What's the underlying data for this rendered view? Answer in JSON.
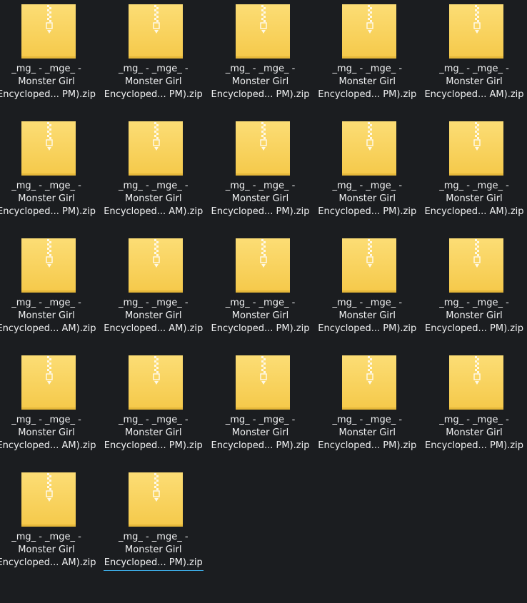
{
  "colors": {
    "background": "#1b1d20",
    "text": "#eff0f1",
    "folder_top": "#fcdd75",
    "folder_bottom": "#f5c94a",
    "zipper": "#ffffff",
    "focus_underline": "#3daee9"
  },
  "icon": "zip-archive-icon",
  "files": [
    {
      "line1": "_mg_ - _mge_ -",
      "line2": "Monster Girl",
      "line3": "Encycloped... PM).zip"
    },
    {
      "line1": "_mg_ - _mge_ -",
      "line2": "Monster Girl",
      "line3": "Encycloped... PM).zip"
    },
    {
      "line1": "_mg_ - _mge_ -",
      "line2": "Monster Girl",
      "line3": "Encycloped... PM).zip"
    },
    {
      "line1": "_mg_ - _mge_ -",
      "line2": "Monster Girl",
      "line3": "Encycloped... PM).zip"
    },
    {
      "line1": "_mg_ - _mge_ -",
      "line2": "Monster Girl",
      "line3": "Encycloped... AM).zip"
    },
    {
      "line1": "_mg_ - _mge_ -",
      "line2": "Monster Girl",
      "line3": "Encycloped... PM).zip"
    },
    {
      "line1": "_mg_ - _mge_ -",
      "line2": "Monster Girl",
      "line3": "Encycloped... AM).zip"
    },
    {
      "line1": "_mg_ - _mge_ -",
      "line2": "Monster Girl",
      "line3": "Encycloped... PM).zip"
    },
    {
      "line1": "_mg_ - _mge_ -",
      "line2": "Monster Girl",
      "line3": "Encycloped... PM).zip"
    },
    {
      "line1": "_mg_ - _mge_ -",
      "line2": "Monster Girl",
      "line3": "Encycloped... AM).zip"
    },
    {
      "line1": "_mg_ - _mge_ -",
      "line2": "Monster Girl",
      "line3": "Encycloped... AM).zip"
    },
    {
      "line1": "_mg_ - _mge_ -",
      "line2": "Monster Girl",
      "line3": "Encycloped... AM).zip"
    },
    {
      "line1": "_mg_ - _mge_ -",
      "line2": "Monster Girl",
      "line3": "Encycloped... PM).zip"
    },
    {
      "line1": "_mg_ - _mge_ -",
      "line2": "Monster Girl",
      "line3": "Encycloped... PM).zip"
    },
    {
      "line1": "_mg_ - _mge_ -",
      "line2": "Monster Girl",
      "line3": "Encycloped... PM).zip"
    },
    {
      "line1": "_mg_ - _mge_ -",
      "line2": "Monster Girl",
      "line3": "Encycloped... AM).zip"
    },
    {
      "line1": "_mg_ - _mge_ -",
      "line2": "Monster Girl",
      "line3": "Encycloped... PM).zip"
    },
    {
      "line1": "_mg_ - _mge_ -",
      "line2": "Monster Girl",
      "line3": "Encycloped... PM).zip"
    },
    {
      "line1": "_mg_ - _mge_ -",
      "line2": "Monster Girl",
      "line3": "Encycloped... PM).zip"
    },
    {
      "line1": "_mg_ - _mge_ -",
      "line2": "Monster Girl",
      "line3": "Encycloped... PM).zip"
    },
    {
      "line1": "_mg_ - _mge_ -",
      "line2": "Monster Girl",
      "line3": "Encycloped... AM).zip"
    },
    {
      "line1": "_mg_ - _mge_ -",
      "line2": "Monster Girl",
      "line3": "Encycloped... PM).zip"
    }
  ],
  "focused_index": 21
}
